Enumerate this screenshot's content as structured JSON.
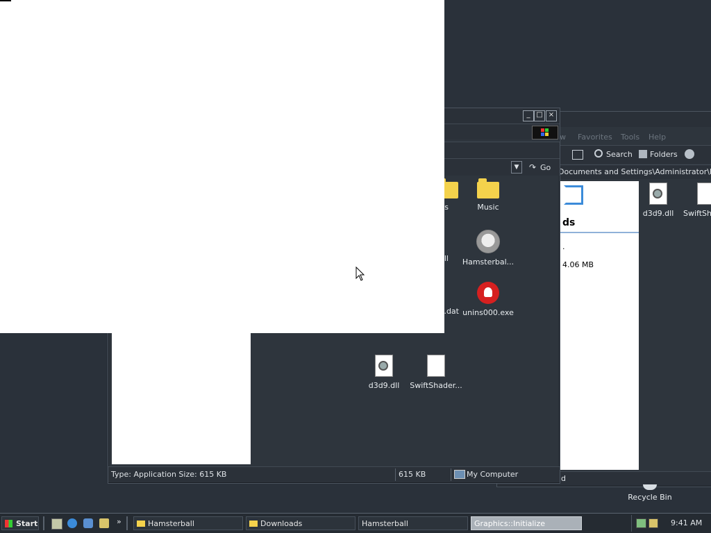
{
  "back_window": {
    "menu": [
      "w",
      "Favorites",
      "Tools",
      "Help"
    ],
    "toolbar": {
      "search": "Search",
      "folders": "Folders"
    },
    "address": "Documents and Settings\\Administrator\\My Do",
    "panel_title": "ds",
    "panel_dot": ".",
    "panel_size": "4.06 MB",
    "files": [
      {
        "name": "d3d9.dll"
      },
      {
        "name": "SwiftSha"
      }
    ],
    "status": "d"
  },
  "front_window": {
    "go_label": "Go",
    "status": {
      "type": "Type: Application Size: 615 KB",
      "size": "615 KB",
      "zone": "My Computer"
    },
    "files": {
      "partial_folder": "s",
      "music": "Music",
      "partial_dll": "ll",
      "hamsterball": "Hamsterbal...",
      "partial_dat": ".dat",
      "unins": "unins000.exe",
      "d3d9": "d3d9.dll",
      "swiftshader": "SwiftShader..."
    }
  },
  "desktop": {
    "recycle_bin": "Recycle Bin"
  },
  "taskbar": {
    "start": "Start",
    "buttons": [
      "Hamsterball",
      "Downloads",
      "Hamsterball",
      "Graphics::Initialize"
    ],
    "clock": "9:41 AM",
    "chevron": "»"
  },
  "colors": {
    "desktop": "#2a313a",
    "window": "#2e353d",
    "white_overlay": "#ffffff"
  }
}
